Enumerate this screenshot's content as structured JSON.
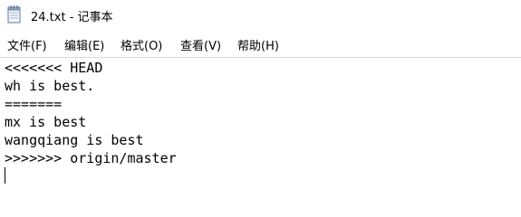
{
  "window": {
    "title": "24.txt - 记事本"
  },
  "icons": {
    "app": "notepad-icon"
  },
  "menu": {
    "items": [
      {
        "label": "文件(F)"
      },
      {
        "label": "编辑(E)"
      },
      {
        "label": "格式(O)"
      },
      {
        "label": "查看(V)"
      },
      {
        "label": "帮助(H)"
      }
    ]
  },
  "editor": {
    "lines": [
      "<<<<<<< HEAD",
      "wh is best.",
      "=======",
      "mx is best",
      "wangqiang is best",
      ">>>>>>> origin/master"
    ]
  }
}
